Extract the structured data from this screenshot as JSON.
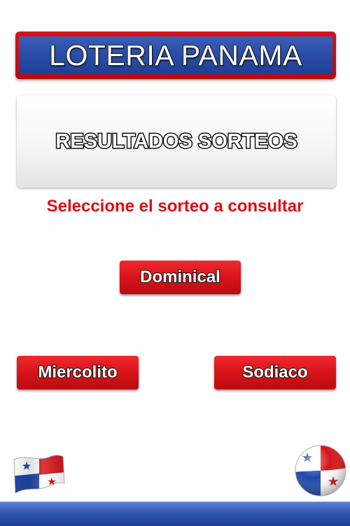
{
  "header": {
    "title": "LOTERIA PANAMA"
  },
  "panel": {
    "title": "RESULTADOS SORTEOS"
  },
  "prompt": "Seleccione el sorteo a consultar",
  "buttons": {
    "dominical": "Dominical",
    "miercolito": "Miercolito",
    "sodiaco": "Sodiaco"
  },
  "icons": {
    "flag": "panama-flag-icon",
    "globe": "panama-globe-icon"
  },
  "colors": {
    "brand_blue": "#2a4ea8",
    "brand_red": "#d8141a",
    "prompt_red": "#e00d15"
  }
}
